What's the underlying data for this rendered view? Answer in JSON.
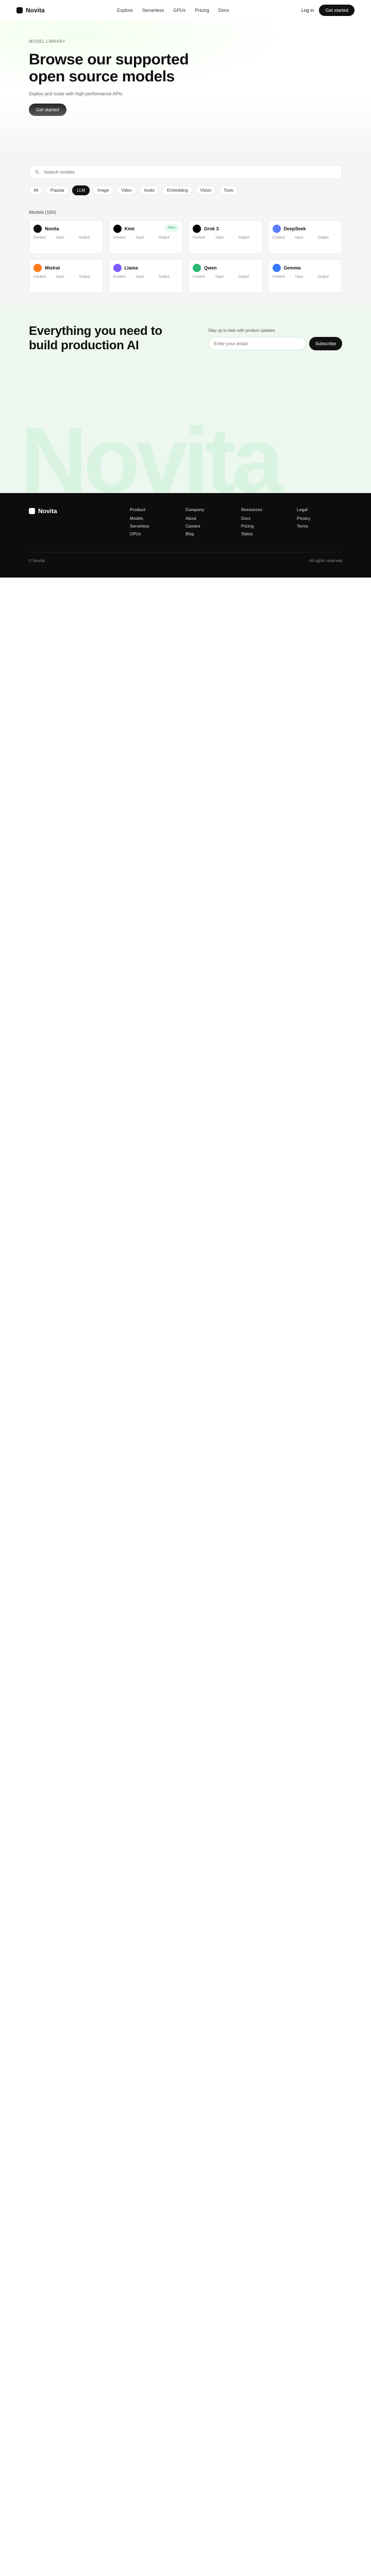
{
  "app": {
    "brand": "Novita",
    "nav": [
      "Explore",
      "Serverless",
      "GPUs",
      "Pricing",
      "Docs"
    ],
    "login": "Log in",
    "cta": "Get started"
  },
  "hero": {
    "eyebrow": "Model Library",
    "title": "Browse our supported open source models",
    "subtitle": "Deploy and scale with high-performance APIs",
    "button": "Get started"
  },
  "filters": {
    "search_placeholder": "Search models",
    "chips": [
      {
        "label": "All",
        "active": false
      },
      {
        "label": "Popular",
        "active": false
      },
      {
        "label": "LLM",
        "active": true
      },
      {
        "label": "Image",
        "active": false
      },
      {
        "label": "Video",
        "active": false
      },
      {
        "label": "Audio",
        "active": false
      },
      {
        "label": "Embedding",
        "active": false
      },
      {
        "label": "Vision",
        "active": false
      },
      {
        "label": "Tools",
        "active": false
      }
    ]
  },
  "catalog": {
    "count_label": "Models (160)",
    "meta_labels": {
      "ctx": "Context",
      "in": "Input",
      "out": "Output"
    },
    "cards": [
      {
        "name": "Novita",
        "badge": "",
        "ctx": "",
        "in": "",
        "out": "",
        "avatar_color": "#111",
        "tags": []
      },
      {
        "name": "Kimi",
        "badge": "New",
        "ctx": "",
        "in": "",
        "out": "",
        "avatar_color": "#000",
        "tags": []
      },
      {
        "name": "Grok 3",
        "badge": "",
        "ctx": "",
        "in": "",
        "out": "",
        "avatar_color": "#000",
        "tags": []
      },
      {
        "name": "DeepSeek",
        "badge": "",
        "ctx": "",
        "in": "",
        "out": "",
        "avatar_color": "#5c7cff",
        "tags": []
      },
      {
        "name": "Mistral",
        "badge": "",
        "ctx": "",
        "in": "",
        "out": "",
        "avatar_color": "#ff7a1a",
        "tags": []
      },
      {
        "name": "Llama",
        "badge": "",
        "ctx": "",
        "in": "",
        "out": "",
        "avatar_color": "#7a5cff",
        "tags": []
      },
      {
        "name": "Qwen",
        "badge": "",
        "ctx": "",
        "in": "",
        "out": "",
        "avatar_color": "#2bb673",
        "tags": []
      },
      {
        "name": "Gemma",
        "badge": "",
        "ctx": "",
        "in": "",
        "out": "",
        "avatar_color": "#3a78ff",
        "tags": []
      }
    ]
  },
  "footer_hero": {
    "title": "Everything you need to build production AI",
    "watermark": "Novita",
    "newsletter_hint": "Stay up to date with product updates",
    "newsletter_placeholder": "Enter your email",
    "newsletter_button": "Subscribe"
  },
  "footer": {
    "brand": "Novita",
    "columns": [
      {
        "title": "Product",
        "links": [
          "Models",
          "Serverless",
          "GPUs"
        ]
      },
      {
        "title": "Company",
        "links": [
          "About",
          "Careers",
          "Blog"
        ]
      },
      {
        "title": "Resources",
        "links": [
          "Docs",
          "Pricing",
          "Status"
        ]
      },
      {
        "title": "Legal",
        "links": [
          "Privacy",
          "Terms"
        ]
      }
    ],
    "copyright": "© Novita",
    "bottom_right": "All rights reserved"
  }
}
